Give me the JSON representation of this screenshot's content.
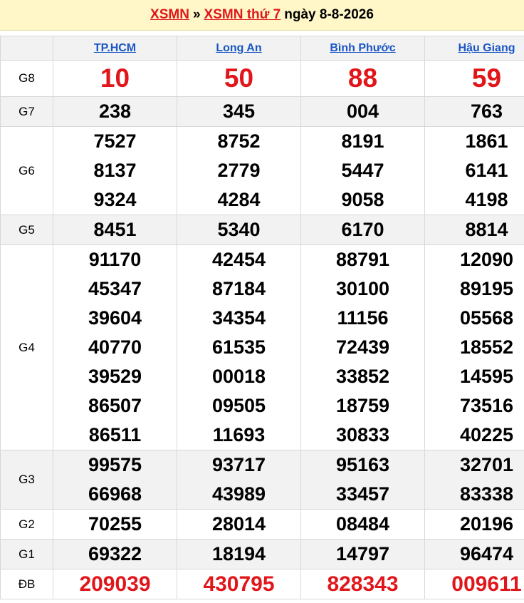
{
  "header": {
    "link1": "XSMN",
    "separator": "»",
    "link2": "XSMN thứ 7",
    "date_text": "ngày 8-8-2026"
  },
  "provinces": [
    "TP.HCM",
    "Long An",
    "Bình Phước",
    "Hậu Giang"
  ],
  "rows": [
    {
      "prize": "G8",
      "values": [
        [
          "10"
        ],
        [
          "50"
        ],
        [
          "88"
        ],
        [
          "59"
        ]
      ]
    },
    {
      "prize": "G7",
      "values": [
        [
          "238"
        ],
        [
          "345"
        ],
        [
          "004"
        ],
        [
          "763"
        ]
      ]
    },
    {
      "prize": "G6",
      "values": [
        [
          "7527",
          "8137",
          "9324"
        ],
        [
          "8752",
          "2779",
          "4284"
        ],
        [
          "8191",
          "5447",
          "9058"
        ],
        [
          "1861",
          "6141",
          "4198"
        ]
      ]
    },
    {
      "prize": "G5",
      "values": [
        [
          "8451"
        ],
        [
          "5340"
        ],
        [
          "6170"
        ],
        [
          "8814"
        ]
      ]
    },
    {
      "prize": "G4",
      "values": [
        [
          "91170",
          "45347",
          "39604",
          "40770",
          "39529",
          "86507",
          "86511"
        ],
        [
          "42454",
          "87184",
          "34354",
          "61535",
          "00018",
          "09505",
          "11693"
        ],
        [
          "88791",
          "30100",
          "11156",
          "72439",
          "33852",
          "18759",
          "30833"
        ],
        [
          "12090",
          "89195",
          "05568",
          "18552",
          "14595",
          "73516",
          "40225"
        ]
      ]
    },
    {
      "prize": "G3",
      "values": [
        [
          "99575",
          "66968"
        ],
        [
          "93717",
          "43989"
        ],
        [
          "95163",
          "33457"
        ],
        [
          "32701",
          "83338"
        ]
      ]
    },
    {
      "prize": "G2",
      "values": [
        [
          "70255"
        ],
        [
          "28014"
        ],
        [
          "08484"
        ],
        [
          "20196"
        ]
      ]
    },
    {
      "prize": "G1",
      "values": [
        [
          "69322"
        ],
        [
          "18194"
        ],
        [
          "14797"
        ],
        [
          "96474"
        ]
      ]
    },
    {
      "prize": "ĐB",
      "values": [
        [
          "209039"
        ],
        [
          "430795"
        ],
        [
          "828343"
        ],
        [
          "009611"
        ]
      ]
    }
  ],
  "colors": {
    "accent_red": "#e0161b",
    "link_blue": "#1a56c4",
    "header_bg": "#fff7c8",
    "alt_row": "#f2f2f2"
  }
}
